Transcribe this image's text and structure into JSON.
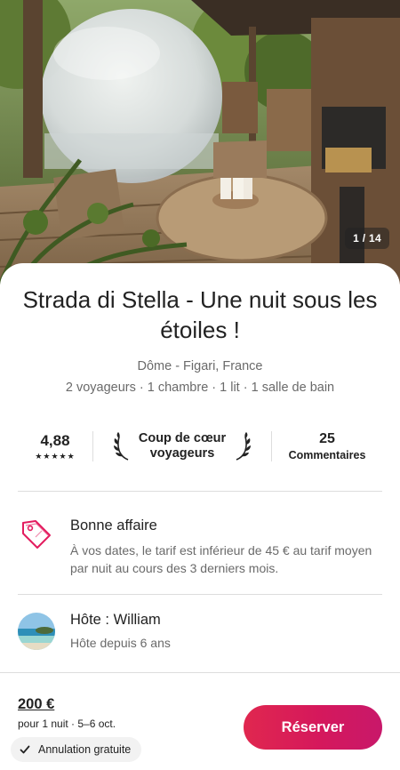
{
  "gallery": {
    "counter": "1 / 14"
  },
  "listing": {
    "title": "Strada di Stella - Une nuit sous les étoiles !",
    "subtitle": "Dôme - Figari, France",
    "details": "2 voyageurs · 1 chambre · 1 lit · 1 salle de bain"
  },
  "stats": {
    "rating": "4,88",
    "stars": "★★★★★",
    "favorite_line1": "Coup de cœur",
    "favorite_line2": "voyageurs",
    "reviews_count": "25",
    "reviews_label": "Commentaires"
  },
  "deal": {
    "title": "Bonne affaire",
    "text": "À vos dates, le tarif est inférieur de 45 € au tarif moyen par nuit au cours des 3 derniers mois.",
    "icon": "price-tag-icon",
    "color": "#E31C5F"
  },
  "host": {
    "name": "Hôte : William",
    "since": "Hôte depuis 6 ans"
  },
  "footer": {
    "price": "200 €",
    "price_detail": "pour 1 nuit · 5–6 oct.",
    "cancellation": "Annulation gratuite",
    "reserve_label": "Réserver"
  },
  "colors": {
    "accent": "#E31C5F",
    "text": "#222222",
    "muted": "#6A6A6A"
  }
}
